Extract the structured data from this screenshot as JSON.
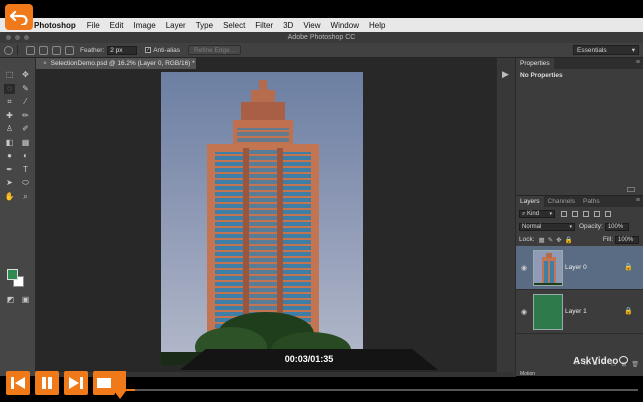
{
  "menubar": {
    "app": "Photoshop",
    "items": [
      "File",
      "Edit",
      "Image",
      "Layer",
      "Type",
      "Select",
      "Filter",
      "3D",
      "View",
      "Window",
      "Help"
    ]
  },
  "window": {
    "title": "Adobe Photoshop CC"
  },
  "options": {
    "feather_label": "Feather:",
    "feather_value": "2 px",
    "antialias_label": "Anti-alias",
    "antialias_checked": true,
    "refine_edge_label": "Refine Edge...",
    "workspace": "Essentials"
  },
  "document": {
    "tab_title": "SelectionDemo.psd @ 16.2% (Layer 0, RGB/16) *"
  },
  "tools": {
    "icons": [
      "move-icon",
      "marquee-icon",
      "lasso-icon",
      "quick-select-icon",
      "crop-icon",
      "eyedropper-icon",
      "healing-icon",
      "brush-icon",
      "clone-stamp-icon",
      "history-brush-icon",
      "eraser-icon",
      "gradient-icon",
      "blur-icon",
      "dodge-icon",
      "pen-icon",
      "type-icon",
      "path-select-icon",
      "shape-icon",
      "hand-icon",
      "zoom-icon"
    ],
    "foreground_color": "#2e8a4e",
    "background_color": "#ffffff"
  },
  "properties_panel": {
    "tab": "Properties",
    "message": "No Properties"
  },
  "layers_panel": {
    "tabs": [
      "Layers",
      "Channels",
      "Paths"
    ],
    "filter_kind": "Kind",
    "blend_mode": "Normal",
    "opacity_label": "Opacity:",
    "opacity_value": "100%",
    "lock_label": "Lock:",
    "fill_label": "Fill:",
    "fill_value": "100%",
    "layers": [
      {
        "name": "Layer 0",
        "selected": true,
        "visible": true,
        "locked": true
      },
      {
        "name": "Layer 1",
        "selected": false,
        "visible": true,
        "locked": true
      }
    ],
    "motion_label": "Motion"
  },
  "player": {
    "timecode": "00:03/01:35",
    "progress": 0.032,
    "brand": "AskVideo",
    "accent_color": "#f07a1a"
  }
}
